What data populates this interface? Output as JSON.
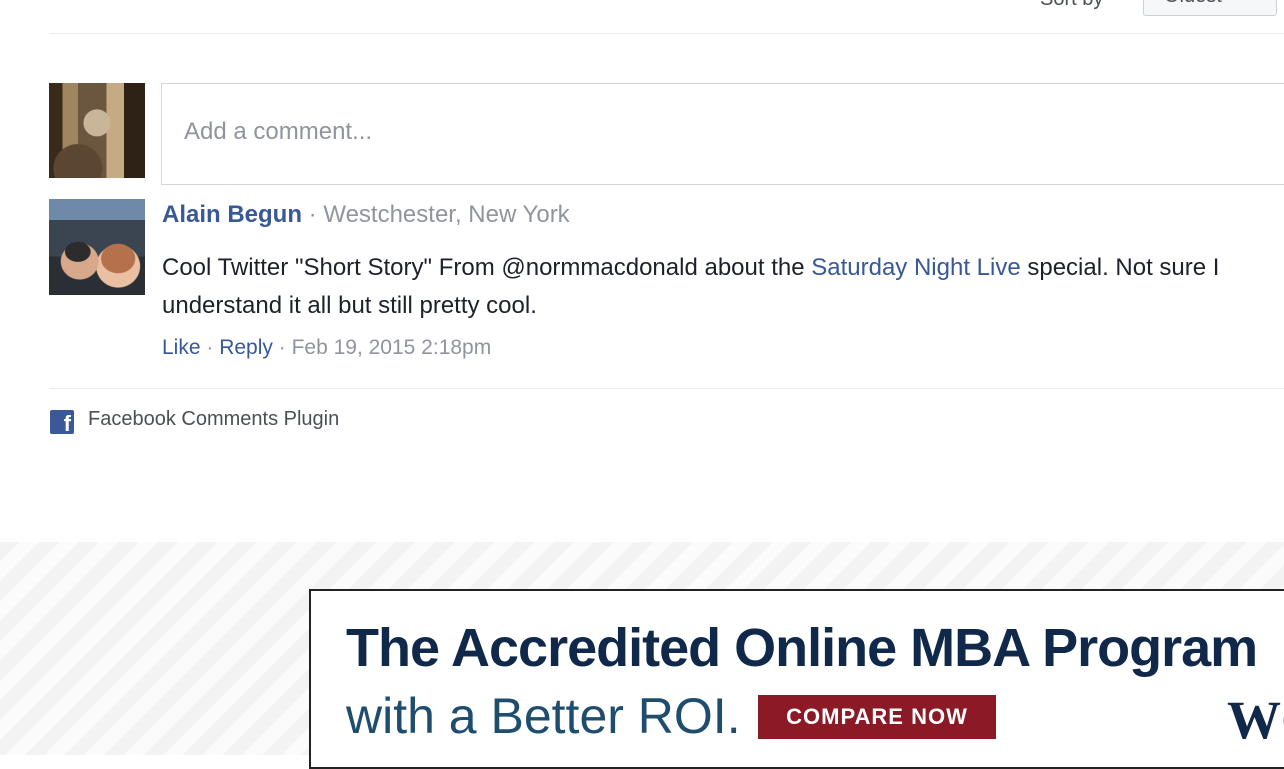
{
  "sort": {
    "label": "Sort by",
    "selected": "Oldest"
  },
  "composer": {
    "placeholder": "Add a comment..."
  },
  "comment": {
    "author": "Alain Begun",
    "separator": " · ",
    "location": "Westchester, New York",
    "text_before": "Cool Twitter \"Short Story\" From @normmacdonald about the ",
    "link_text": "Saturday Night Live",
    "text_after": " special. Not sure I understand it all but still pretty cool.",
    "like_label": "Like",
    "reply_label": "Reply",
    "timestamp": "Feb 19, 2015 2:18pm"
  },
  "plugin": {
    "icon": "f",
    "label": "Facebook Comments Plugin"
  },
  "ad": {
    "headline": "The Accredited Online MBA Program",
    "subline": "with a Better ROI.",
    "cta": "COMPARE NOW",
    "logo_text": "WC"
  },
  "colors": {
    "link": "#385898",
    "meta": "#90949c",
    "facebook_blue": "#3b5998",
    "ad_navy": "#10284a",
    "ad_cta": "#8b1a26"
  }
}
